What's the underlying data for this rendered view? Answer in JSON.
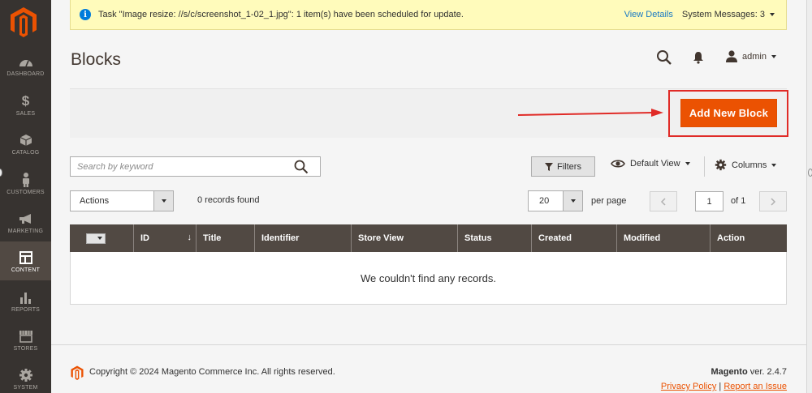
{
  "sidebar": {
    "items": [
      {
        "label": "DASHBOARD",
        "icon": "dashboard-icon"
      },
      {
        "label": "SALES",
        "icon": "dollar-icon"
      },
      {
        "label": "CATALOG",
        "icon": "cube-icon"
      },
      {
        "label": "CUSTOMERS",
        "icon": "person-icon"
      },
      {
        "label": "MARKETING",
        "icon": "megaphone-icon"
      },
      {
        "label": "CONTENT",
        "icon": "layout-icon"
      },
      {
        "label": "REPORTS",
        "icon": "bar-chart-icon"
      },
      {
        "label": "STORES",
        "icon": "storefront-icon"
      },
      {
        "label": "SYSTEM",
        "icon": "gear-icon"
      }
    ],
    "active": "CONTENT"
  },
  "message": {
    "text": "Task \"Image resize: //s/c/screenshot_1-02_1.jpg\": 1 item(s) have been scheduled for update.",
    "view_details": "View Details",
    "system_messages": "System Messages: 3"
  },
  "header": {
    "title": "Blocks",
    "user": "admin"
  },
  "actions": {
    "add_button": "Add New Block"
  },
  "toolbar": {
    "search_placeholder": "Search by keyword",
    "filters": "Filters",
    "view": "Default View",
    "columns": "Columns",
    "mass_actions": "Actions",
    "records_found": "0 records found",
    "per_page_value": "20",
    "per_page_label": "per page",
    "current_page": "1",
    "of_pages": "of 1"
  },
  "grid": {
    "columns": [
      "ID",
      "Title",
      "Identifier",
      "Store View",
      "Status",
      "Created",
      "Modified",
      "Action"
    ],
    "sort_indicator": "↓",
    "empty_message": "We couldn't find any records."
  },
  "footer": {
    "copyright": "Copyright © 2024 Magento Commerce Inc. All rights reserved.",
    "brand": "Magento",
    "version": "ver. 2.4.7",
    "privacy": "Privacy Policy",
    "separator": "|",
    "report": "Report an Issue"
  },
  "colors": {
    "sidebar_bg": "#373330",
    "accent": "#eb5202",
    "grid_header": "#514943",
    "message_bg": "#fffbbb",
    "link": "#1979c3",
    "highlight_frame": "#e02b27"
  }
}
